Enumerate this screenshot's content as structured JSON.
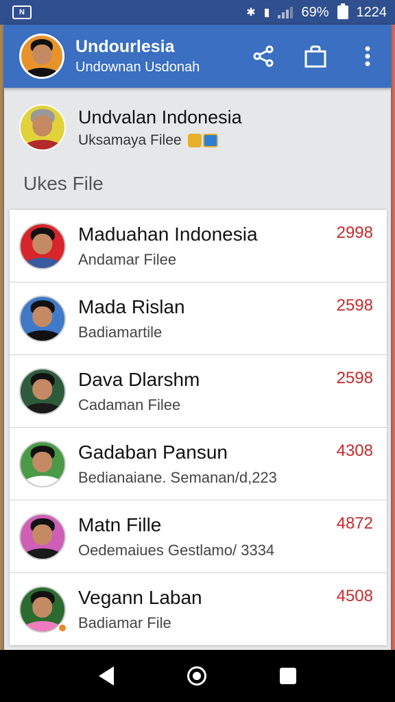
{
  "status_bar": {
    "battery_text": "69%",
    "time": "1224"
  },
  "app_bar": {
    "title": "Undourlesia",
    "subtitle": "Undownan Usdonah",
    "actions": [
      "share-icon",
      "bag-icon",
      "more-vert-icon"
    ]
  },
  "profile": {
    "name": "Undvalan Indonesia",
    "subtitle": "Uksamaya Filee"
  },
  "section": {
    "title": "Ukes File"
  },
  "contacts": [
    {
      "name": "Maduahan Indonesia",
      "sub": "Andamar Filee",
      "count": "2998",
      "avatar_color": "#d7262b",
      "body_color": "#3a5aa0"
    },
    {
      "name": "Mada Rislan",
      "sub": "Badiamartile",
      "count": "2598",
      "avatar_color": "#3f79c7",
      "body_color": "#111111"
    },
    {
      "name": "Dava Dlarshm",
      "sub": "Cadaman Filee",
      "count": "2598",
      "avatar_color": "#2e5b3c",
      "body_color": "#1a1a1a"
    },
    {
      "name": "Gadaban Pansun",
      "sub": "Bedianaiane. Semanan/d,223",
      "count": "4308",
      "avatar_color": "#4a9a47",
      "body_color": "#ffffff"
    },
    {
      "name": "Matn Fille",
      "sub": "Oedemaiues Gestlamo/ 3334",
      "count": "4872",
      "avatar_color": "#cf5fb6",
      "body_color": "#1a1a1a"
    },
    {
      "name": "Vegann Laban",
      "sub": "Badiamar File",
      "count": "4508",
      "avatar_color": "#2c6b2f",
      "body_color": "#f07cc0"
    }
  ],
  "colors": {
    "app_bar": "#3a6fc1",
    "status_bar": "#2f4f8f",
    "count_red": "#c8282a"
  }
}
